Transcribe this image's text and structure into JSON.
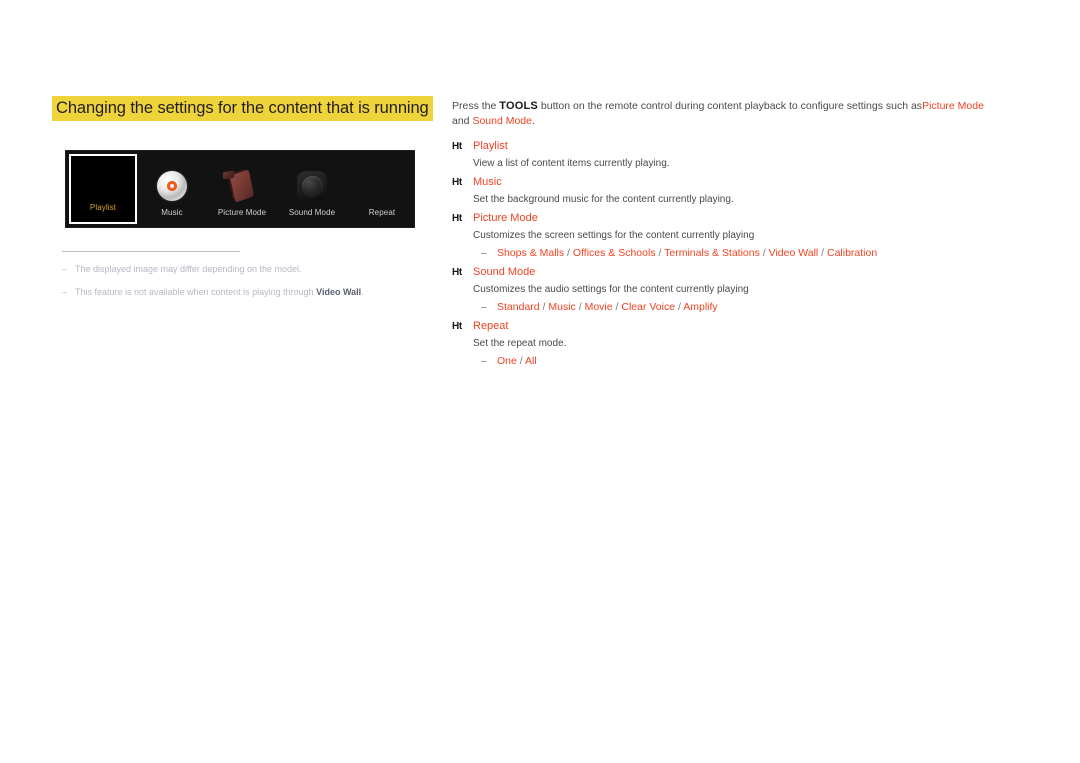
{
  "page": {
    "heading": "Changing the settings for the content that is running"
  },
  "menu_bar": {
    "tiles": [
      {
        "label": "Playlist",
        "icon": "playlist-icon",
        "selected": true
      },
      {
        "label": "Music",
        "icon": "cd-disc-icon",
        "selected": false
      },
      {
        "label": "Picture Mode",
        "icon": "picture-panel-icon",
        "selected": false
      },
      {
        "label": "Sound Mode",
        "icon": "speaker-icon",
        "selected": false
      },
      {
        "label": "Repeat",
        "icon": "none",
        "selected": false
      }
    ]
  },
  "footnotes": {
    "dash": "–",
    "items": [
      {
        "text": "The displayed image may differ depending on the model.",
        "bold_tail": ""
      },
      {
        "text": "This feature is not available when content is playing through ",
        "bold_tail": "Video Wall",
        "tail": "."
      }
    ]
  },
  "intro": {
    "part1": "Press the ",
    "tools": "TOOLS",
    "part2": " button on the remote control during content playback to configure settings such as",
    "keyword1": "Picture Mode",
    "part3": " and ",
    "keyword2": "Sound Mode",
    "part4": "."
  },
  "bullet_glyph": "Ht",
  "option_dash": "–",
  "entries": [
    {
      "title": "Playlist",
      "desc": "View a list of content items currently playing.",
      "options": []
    },
    {
      "title": "Music",
      "desc": "Set the background music for the content currently playing.",
      "options": []
    },
    {
      "title": "Picture Mode",
      "desc": "Customizes the screen settings for the content currently playing",
      "options": [
        "Shops & Malls",
        "Offices & Schools",
        "Terminals & Stations",
        "Video Wall",
        "Calibration"
      ]
    },
    {
      "title": "Sound Mode",
      "desc": "Customizes the audio settings for the content currently playing",
      "options": [
        "Standard",
        "Music",
        "Movie",
        "Clear Voice",
        "Amplify"
      ]
    },
    {
      "title": "Repeat",
      "desc": "Set the repeat mode.",
      "options": [
        "One",
        "All"
      ]
    }
  ],
  "colors": {
    "accent_red": "#ef4323",
    "highlight_yellow": "#efd33a",
    "body_gray": "#4a4a4a",
    "footnote_gray": "#b4b8c6",
    "selected_label": "#d8a021"
  }
}
